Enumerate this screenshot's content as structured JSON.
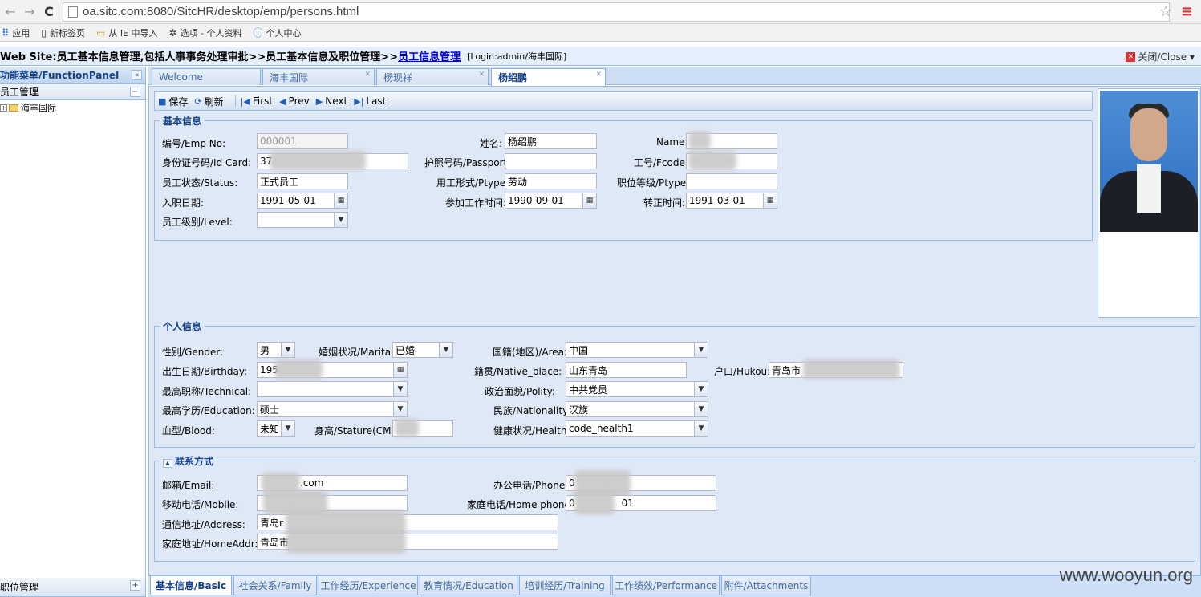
{
  "browser": {
    "url": "oa.sitc.com:8080/SitcHR/desktop/emp/persons.html",
    "bookmarks": [
      "应用",
      "新标签页",
      "从 IE 中导入",
      "选项 - 个人资料",
      "个人中心"
    ]
  },
  "header": {
    "crumb_prefix": "Web Site:员工基本信息管理,包括人事事务处理审批>>员工基本信息及职位管理>>",
    "crumb_link": "员工信息管理",
    "login": "[Login:admin/海丰国际]",
    "close_label": "关闭/Close ▾"
  },
  "sidebar": {
    "title": "功能菜单/FunctionPanel",
    "section1": "员工管理",
    "tree_node": "海丰国际",
    "section2": "职位管理"
  },
  "tabs": [
    {
      "label": "Welcome"
    },
    {
      "label": "海丰国际"
    },
    {
      "label": "杨现祥"
    },
    {
      "label": "杨绍鹏"
    }
  ],
  "toolbar": {
    "save": "保存",
    "refresh": "刷新",
    "first": "First",
    "prev": "Prev",
    "next": "Next",
    "last": "Last"
  },
  "basic": {
    "legend": "基本信息",
    "emp_no_label": "编号/Emp No:",
    "emp_no": "000001",
    "name_cn_label": "姓名:",
    "name_cn": "杨绍鹏",
    "name_en_label": "Name:",
    "idcard_label": "身份证号码/Id Card:",
    "idcard": "37",
    "passport_label": "护照号码/Passport:",
    "fcode_label": "工号/Fcode:",
    "status_label": "员工状态/Status:",
    "status": "正式员工",
    "ptype_label": "用工形式/Ptype:",
    "ptype": "劳动",
    "ptype2_label": "职位等级/Ptype:",
    "hire_label": "入职日期:",
    "hire": "1991-05-01",
    "work_label": "参加工作时间:",
    "work": "1990-09-01",
    "regular_label": "转正时间:",
    "regular": "1991-03-01",
    "level_label": "员工级别/Level:"
  },
  "personal": {
    "legend": "个人信息",
    "gender_label": "性别/Gender:",
    "gender": "男",
    "marital_label": "婚姻状况/Marital:",
    "marital": "已婚",
    "area_label": "国籍(地区)/Area:",
    "area": "中国",
    "birth_label": "出生日期/Birthday:",
    "birth": "195",
    "native_label": "籍贯/Native_place:",
    "native": "山东青岛",
    "hukou_label": "户口/Hukou:",
    "hukou": "青岛市",
    "tech_label": "最高职称/Technical:",
    "polity_label": "政治面貌/Polity:",
    "polity": "中共党员",
    "edu_label": "最高学历/Education:",
    "edu": "硕士",
    "nation_label": "民族/Nationality:",
    "nation": "汉族",
    "blood_label": "血型/Blood:",
    "blood": "未知",
    "stature_label": "身高/Stature(CM):",
    "health_label": "健康状况/Health:",
    "health": "code_health1"
  },
  "contact": {
    "legend": "联系方式",
    "email_label": "邮箱/Email:",
    "email": ".com",
    "phone_label": "办公电话/Phone:",
    "phone": "0",
    "mobile_label": "移动电话/Mobile:",
    "homephone_label": "家庭电话/Home phone:",
    "homephone": "0",
    "homephone_tail": "01",
    "address_label": "通信地址/Address:",
    "address": "青岛r",
    "homeaddr_label": "家庭地址/HomeAddr:",
    "homeaddr": "青岛市"
  },
  "bottom_tabs": [
    "基本信息/Basic",
    "社会关系/Family",
    "工作经历/Experience",
    "教育情况/Education",
    "培训经历/Training",
    "工作绩效/Performance",
    "附件/Attachments"
  ],
  "watermark": "www.wooyun.org"
}
